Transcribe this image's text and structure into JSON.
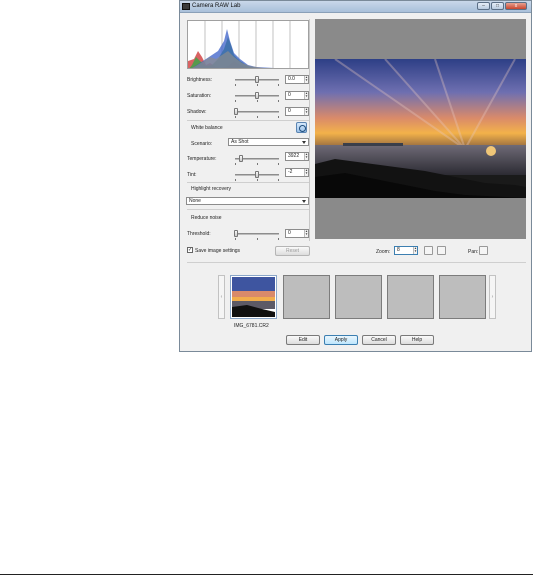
{
  "window": {
    "title": "Camera RAW Lab",
    "minimize_label": "‒",
    "maximize_label": "□",
    "close_label": "x"
  },
  "adjustments": {
    "brightness": {
      "label": "Brightness:",
      "value": "0.0",
      "level": 0.5
    },
    "saturation": {
      "label": "Saturation:",
      "value": "0",
      "level": 0.5
    },
    "shadow": {
      "label": "Shadow:",
      "value": "0",
      "level": 0.0
    }
  },
  "white_balance": {
    "heading": "White balance",
    "scenario_label": "Scenario:",
    "scenario_value": "As Shot",
    "temperature": {
      "label": "Temperature:",
      "value": "3922",
      "level": 0.1
    },
    "tint": {
      "label": "Tint:",
      "value": "-2",
      "level": 0.5
    }
  },
  "highlight": {
    "heading": "Highlight recovery",
    "value": "None"
  },
  "noise": {
    "heading": "Reduce noise",
    "threshold_label": "Threshold:",
    "threshold_value": "0",
    "level": 0.0
  },
  "bottom_controls": {
    "save_label": "Save image settings",
    "save_checked": true,
    "check_mark": "✓",
    "reset_label": "Reset",
    "zoom_label": "Zoom:",
    "zoom_value": "8",
    "pan_label": "Pan:"
  },
  "thumbnails": {
    "items": [
      {
        "caption": "IMG_6781.CR2",
        "selected": true
      },
      {
        "caption": "",
        "selected": false
      },
      {
        "caption": "",
        "selected": false
      },
      {
        "caption": "",
        "selected": false
      },
      {
        "caption": "",
        "selected": false
      }
    ],
    "prev_label": "‹",
    "next_label": "›"
  },
  "dialog_buttons": {
    "edit": "Edit",
    "apply": "Apply",
    "cancel": "Cancel",
    "help": "Help"
  }
}
